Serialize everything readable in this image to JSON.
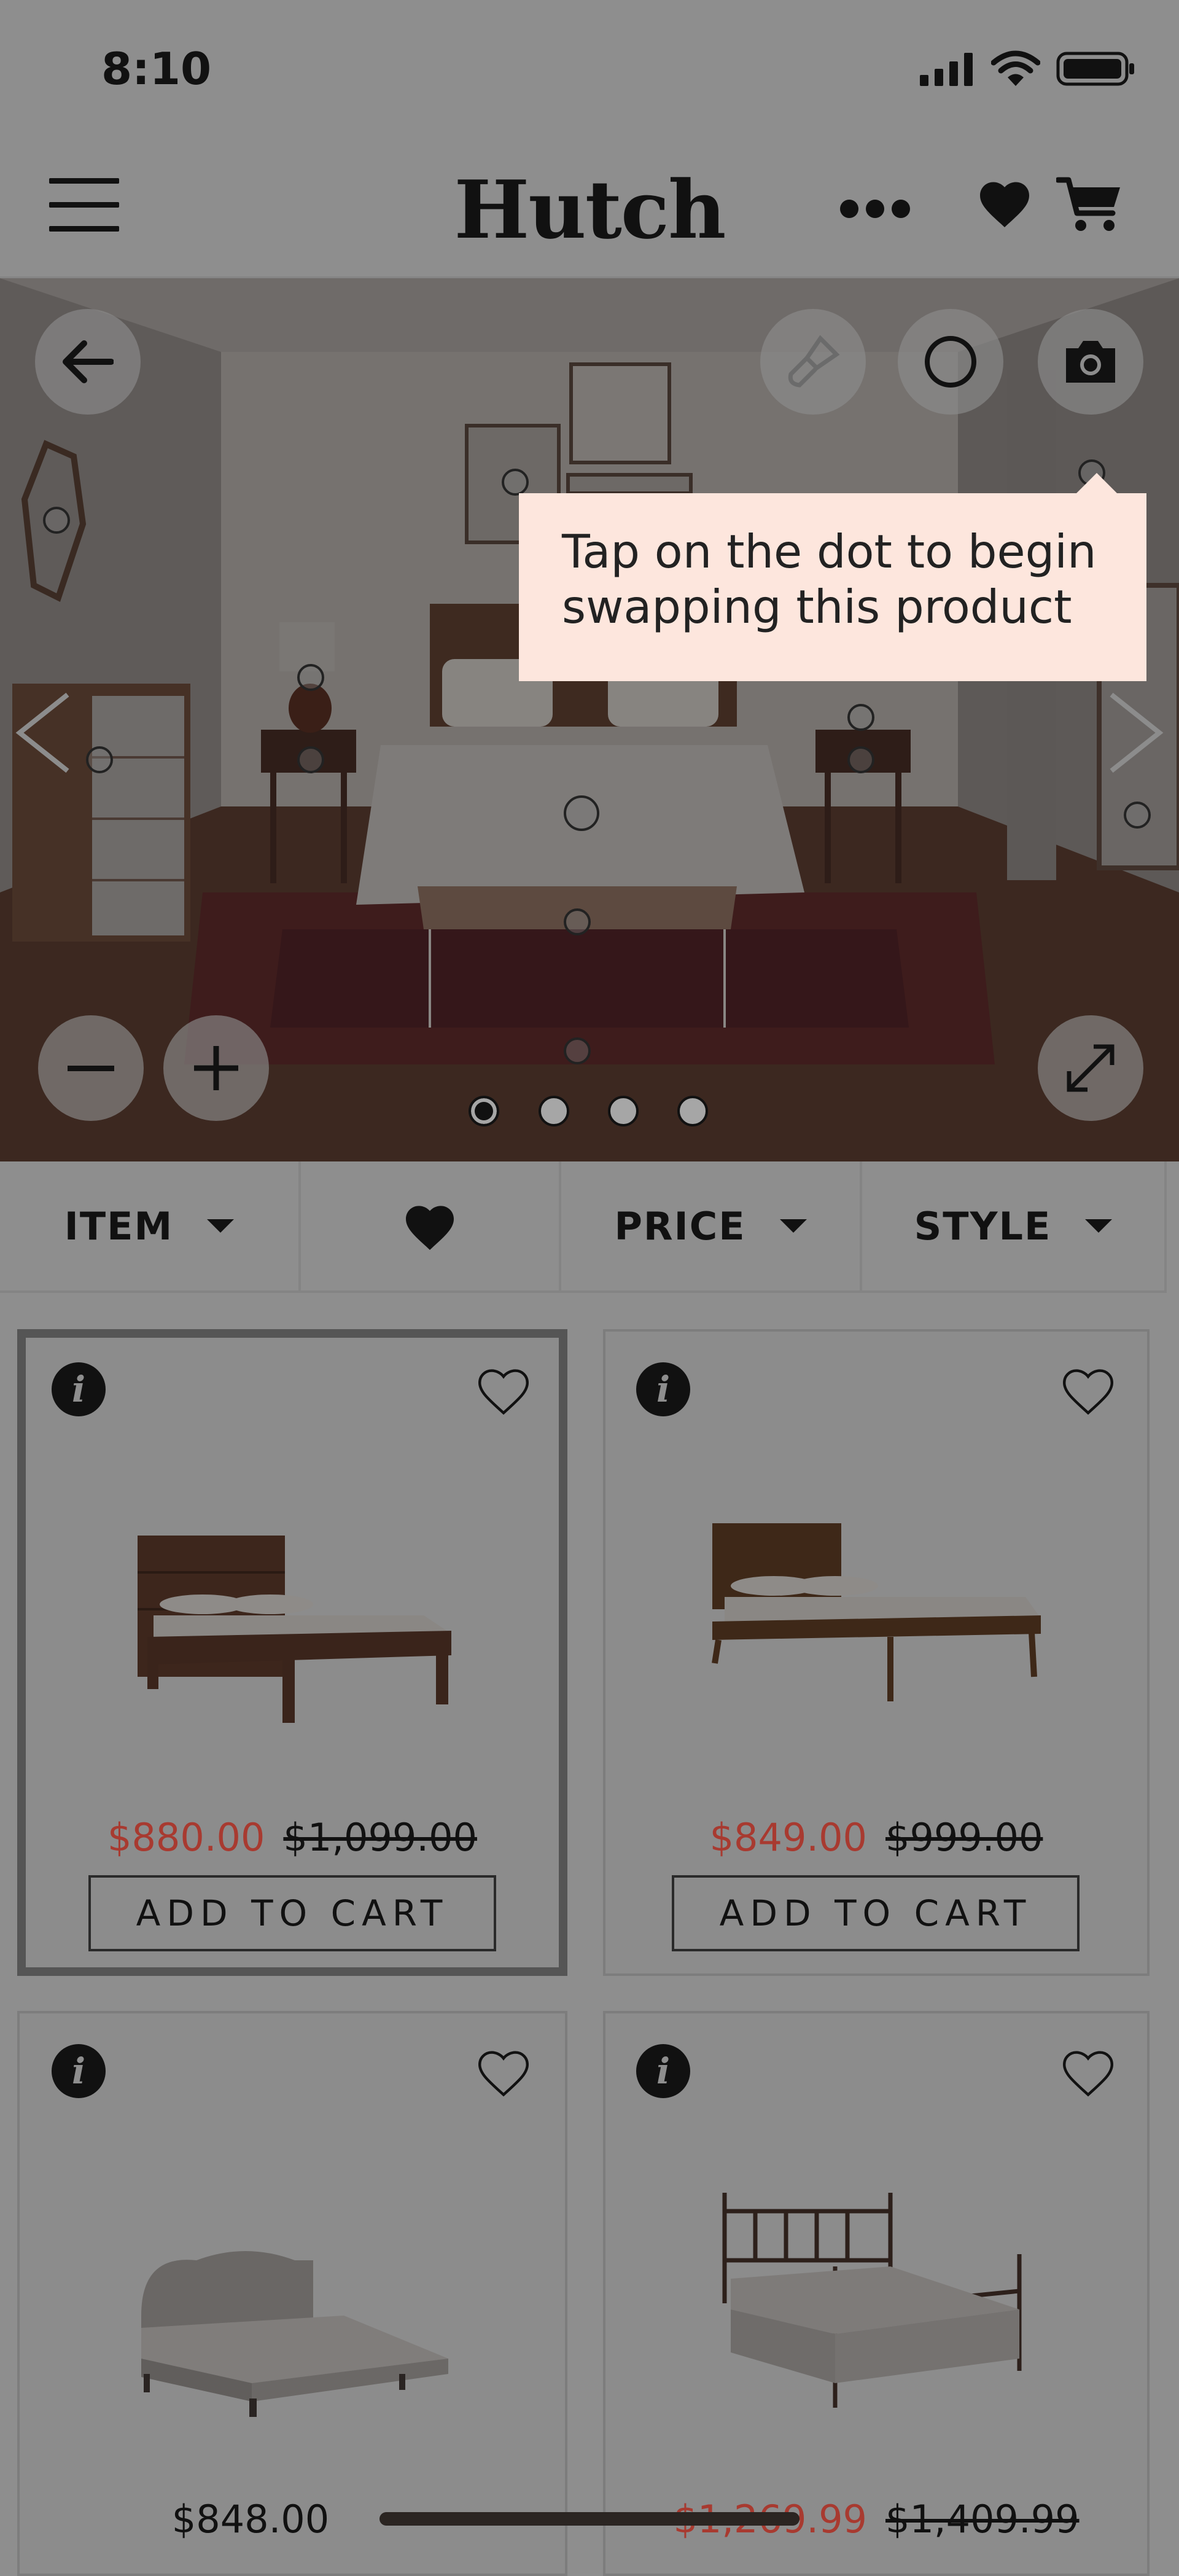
{
  "status_bar": {
    "time": "8:10"
  },
  "header": {
    "brand": "Hutch"
  },
  "hero": {
    "tooltip": "Tap on the dot to begin swapping this product",
    "slide_count": 4,
    "active_slide": 1
  },
  "filters": [
    {
      "label": "ITEM",
      "has_dropdown": true
    },
    {
      "label": "",
      "icon": "heart-icon",
      "has_dropdown": false
    },
    {
      "label": "PRICE",
      "has_dropdown": true
    },
    {
      "label": "STYLE",
      "has_dropdown": true
    }
  ],
  "products": [
    {
      "sale_price": "$880.00",
      "original_price": "$1,099.00",
      "cta": "ADD TO CART",
      "selected": true
    },
    {
      "sale_price": "$849.00",
      "original_price": "$999.00",
      "cta": "ADD TO CART",
      "selected": false
    },
    {
      "price": "$848.00",
      "selected": false
    },
    {
      "sale_price": "$1,269.99",
      "original_price": "$1,409.99",
      "selected": false
    }
  ],
  "colors": {
    "sale": "#a83a30",
    "tooltip_bg": "#fde6dd",
    "overlay": "#8e8e8e"
  }
}
